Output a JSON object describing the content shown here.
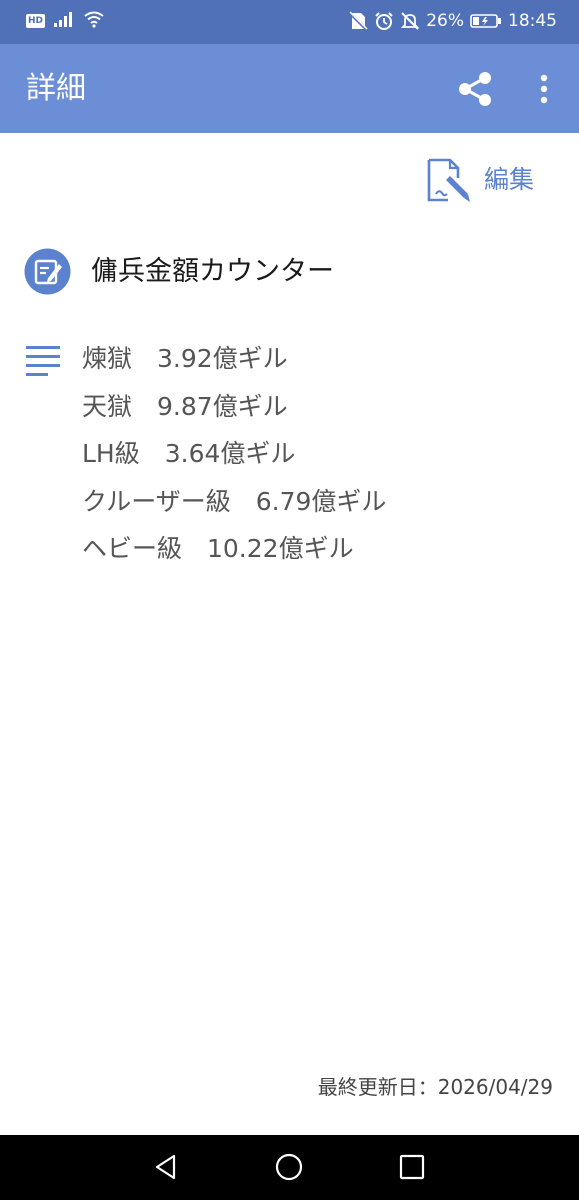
{
  "status_bar": {
    "hd": "HD",
    "battery": "26%",
    "time": "18:45",
    "icons": [
      "signal-icon",
      "wifi-icon",
      "no-sim-icon",
      "alarm-icon",
      "mute-icon",
      "battery-icon"
    ]
  },
  "app_bar": {
    "title": "詳細",
    "actions": [
      "share-icon",
      "more-vert-icon"
    ]
  },
  "edit": {
    "label": "編集",
    "icon": "edit-document-icon"
  },
  "note": {
    "title": "傭兵金額カウンター",
    "title_icon": "note-edit-icon",
    "body_icon": "text-lines-icon",
    "lines": [
      "煉獄　3.92億ギル",
      "天獄　9.87億ギル",
      "LH級　3.64億ギル",
      "クルーザー級　6.79億ギル",
      "ヘビー級　10.22億ギル"
    ]
  },
  "footer": {
    "last_updated": "最終更新日：2026/04/29"
  },
  "nav_bar": {
    "buttons": [
      "back-icon",
      "home-icon",
      "recent-apps-icon"
    ]
  },
  "colors": {
    "status_bar": "#5071b8",
    "app_bar": "#6b8ed6",
    "accent": "#5b82cc",
    "nav_bar": "#000000"
  }
}
